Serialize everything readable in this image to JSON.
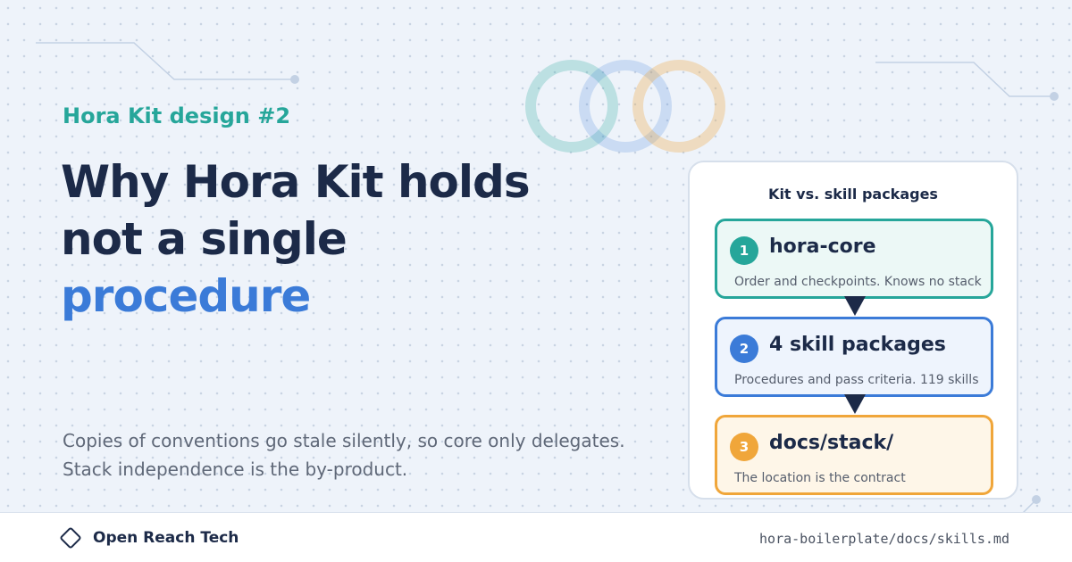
{
  "kicker": "Hora Kit design #2",
  "title": {
    "line1": "Why Hora Kit holds",
    "line2": "not a single",
    "accent": "procedure"
  },
  "description": {
    "line1": "Copies of conventions go stale silently, so core only delegates.",
    "line2": "Stack independence is the by-product."
  },
  "panel": {
    "title": "Kit vs. skill packages",
    "steps": [
      {
        "number": "1",
        "title": "hora-core",
        "desc": "Order and checkpoints. Knows no stack",
        "color": "#26a69a",
        "bg": "#ecf8f6"
      },
      {
        "number": "2",
        "title": "4 skill packages",
        "desc": "Procedures and pass criteria. 119 skills",
        "color": "#3b7bd8",
        "bg": "#eef4fd"
      },
      {
        "number": "3",
        "title": "docs/stack/",
        "desc": "The location is the contract",
        "color": "#f0a63a",
        "bg": "#fef6e8"
      }
    ]
  },
  "footer": {
    "brand": "Open Reach Tech",
    "path": "hora-boilerplate/docs/skills.md"
  },
  "colors": {
    "teal": "#26a69a",
    "blue": "#3b7bd8",
    "orange": "#f0a63a",
    "navy": "#1c2a48"
  }
}
